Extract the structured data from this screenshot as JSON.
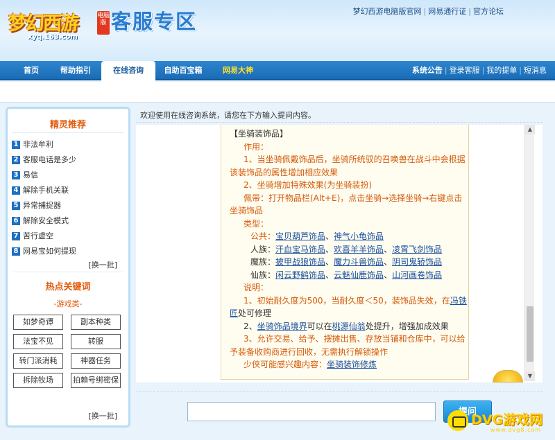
{
  "header": {
    "logo_text": "梦幻西游",
    "logo_badge": "电脑版",
    "logo_url": "xyq.163.com",
    "zone_title": "客服专区",
    "top_links": [
      "梦幻西游电脑版官网",
      "网易通行证",
      "官方论坛"
    ]
  },
  "nav": {
    "items": [
      "首页",
      "帮助指引",
      "在线咨询",
      "自助百宝箱",
      "网易大神"
    ],
    "active": "在线咨询",
    "right_links": [
      "系统公告",
      "登录客服",
      "我的提单",
      "短消息"
    ]
  },
  "left": {
    "tips_title": "精灵推荐",
    "tips": [
      {
        "num": "1",
        "label": "非法牟利"
      },
      {
        "num": "2",
        "label": "客服电话是多少"
      },
      {
        "num": "3",
        "label": "易信"
      },
      {
        "num": "4",
        "label": "解除手机关联"
      },
      {
        "num": "5",
        "label": "异常捕捉器"
      },
      {
        "num": "6",
        "label": "解除安全模式"
      },
      {
        "num": "7",
        "label": "苦行虚空"
      },
      {
        "num": "8",
        "label": "网易宝如何提现"
      }
    ],
    "more_label": "[换一批]",
    "hot_title": "热点关键词",
    "hot_category": "-游戏类-",
    "keywords": [
      "如梦奇谭",
      "副本种类",
      "法宝不见",
      "转服",
      "转门派消耗",
      "神器任务",
      "拆除牧场",
      "拍賴号绑密保"
    ],
    "more2_label": "[换一批]"
  },
  "main": {
    "welcome": "欢迎使用在线咨询系统，请您在下方输入提问内容。",
    "send_label": "提问",
    "input_value": ""
  },
  "answer": {
    "heading": "【坐骑装饰品】",
    "usage_label": "作用：",
    "usage1": "1、当坐骑佩戴饰品后，坐骑所统驭的召唤兽在战斗中会根据",
    "usage1b": "该装饰品的属性增加相应效果",
    "usage2": "2、坐骑增加特殊效果(为坐骑装扮)",
    "wear1": "佩带：打开物品栏(Alt+E)，点击坐骑→选择坐骑→右键点击",
    "wear1b": "坐骑饰品",
    "type_label": "类型：",
    "types": [
      {
        "race": "公共：",
        "items": [
          "宝贝葫芦饰品",
          "神气小龟饰品"
        ]
      },
      {
        "race": "人族：",
        "items": [
          "汗血宝马饰品",
          "欢喜羊羊饰品",
          "凌霄飞剑饰品"
        ]
      },
      {
        "race": "魔族：",
        "items": [
          "披甲战狼饰品",
          "魔力斗兽饰品",
          "阴司鬼轿饰品"
        ]
      },
      {
        "race": "仙族：",
        "items": [
          "闲云野鹤饰品",
          "云魅仙鹿饰品",
          "山河画卷饰品"
        ]
      }
    ],
    "note_label": "说明：",
    "note1a": "1、初始耐久度为500，当耐久度＜50，装饰品失效，在",
    "note1_link": "冯铁",
    "note1_link2": "匠",
    "note1b": "处可修理",
    "note2a": "2、",
    "note2_link": "坐骑饰品境界",
    "note2b": "可以在",
    "note2_link2": "桃源仙翁",
    "note2c": "处提升，增强加成效果",
    "note3a": "3、允许交易、给予、摆摊出售、存放当铺和仓库中，可以给",
    "note3b": "予装备收购商进行回收，无需执行解锁操作",
    "interest_label": "少侠可能感兴趣内容：",
    "interest_link": "坐骑装饰修炼"
  },
  "watermark": {
    "text": "DVG游戏网",
    "url": "www.dvg8.com"
  },
  "colors": {
    "nav_blue": "#1a6bb5",
    "accent_orange": "#e35a0c",
    "link_blue": "#1a4fa0",
    "bubble_bg": "#fffdf0"
  }
}
